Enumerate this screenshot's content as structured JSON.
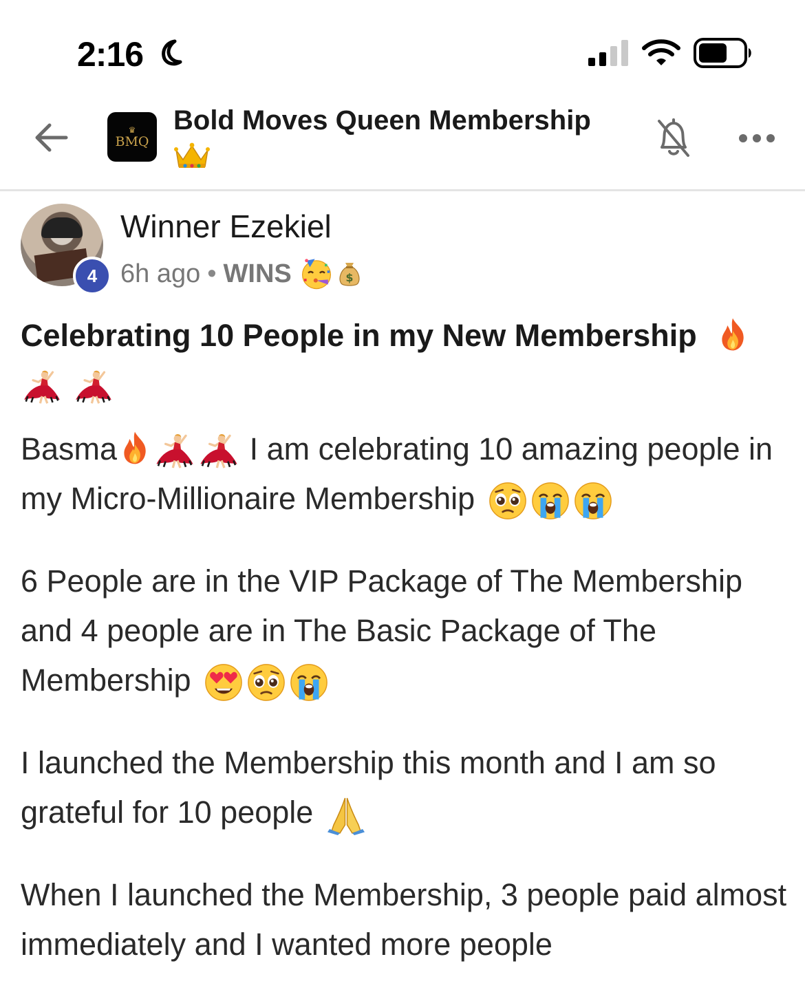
{
  "status_bar": {
    "time": "2:16"
  },
  "header": {
    "group_title": "Bold Moves Queen Membership",
    "logo_text": "BMQ",
    "back_icon": "arrow-left-icon",
    "bell_icon": "bell-off-icon",
    "more_icon": "more-dots-icon"
  },
  "post": {
    "author_name": "Winner Ezekiel",
    "level": "4",
    "time_ago": "6h ago",
    "category": "WINS",
    "title": "Celebrating 10 People in my New Membership",
    "paragraphs": {
      "p1_a": "Basma",
      "p1_b": "I am celebrating 10 amazing people in my Micro-Millionaire Membership",
      "p2": "6 People are in the VIP Package of The Membership and 4 people are in The Basic Package of The Membership",
      "p3": "I launched the Membership this month and I am so grateful for 10 people",
      "p4": "When I launched the Membership, 3 people paid almost immediately and I wanted more people"
    }
  },
  "colors": {
    "level_badge": "#3a4fb0",
    "divider": "#e4e4e4",
    "meta_text": "#777777"
  }
}
